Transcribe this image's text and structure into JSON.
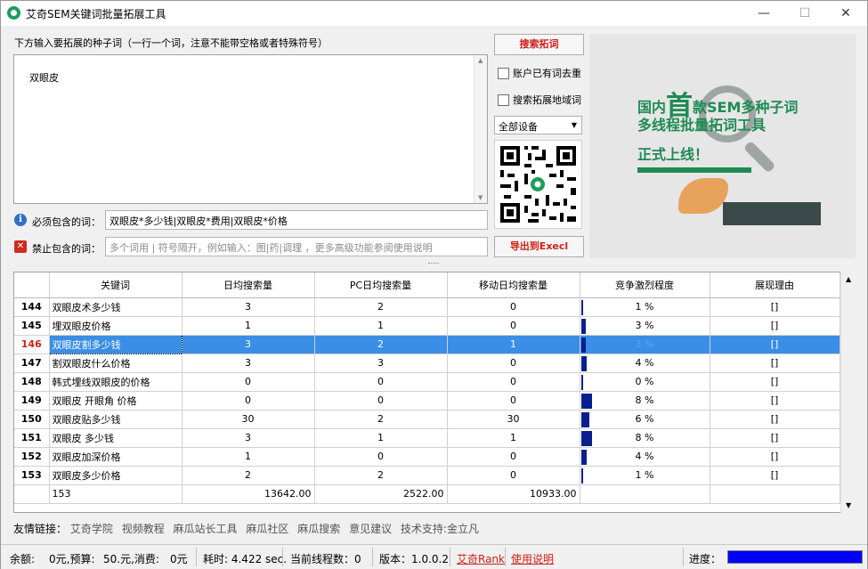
{
  "window": {
    "title": "艾奇SEM关键词批量拓展工具",
    "min": "—",
    "max": "☐",
    "close": "✕"
  },
  "seed": {
    "label": "下方输入要拓展的种子词（一行一个词，注意不能带空格或者特殊符号）",
    "value": "双眼皮"
  },
  "include": {
    "label": "必须包含的词：",
    "value": "双眼皮*多少钱|双眼皮*费用|双眼皮*价格"
  },
  "exclude": {
    "label": "禁止包含的词：",
    "placeholder": "多个词用 | 符号隔开，例如输入：图|药|调理 ，更多高级功能参阅使用说明"
  },
  "controls": {
    "search_button": "搜索拓词",
    "dedupe_checkbox": "账户已有词去重",
    "region_checkbox": "搜索拓展地域词",
    "device_select": "全部设备",
    "export_button": "导出到Execl"
  },
  "banner": {
    "line1_pre": "国内",
    "line1_big": "首",
    "line1_post": "款SEM多种子词",
    "line2": "多线程批量拓词工具",
    "line3": "正式上线！"
  },
  "table": {
    "headers": [
      "",
      "关键词",
      "日均搜索量",
      "PC日均搜索量",
      "移动日均搜索量",
      "竞争激烈程度",
      "展现理由"
    ],
    "rows": [
      {
        "num": "144",
        "kw": "双眼皮术多少钱",
        "daily": "3",
        "pc": "2",
        "mobile": "0",
        "comp": "1 %",
        "comp_level": 0.01,
        "reason": "[]"
      },
      {
        "num": "145",
        "kw": "埋双眼皮价格",
        "daily": "1",
        "pc": "1",
        "mobile": "0",
        "comp": "3 %",
        "comp_level": 0.03,
        "reason": "[]"
      },
      {
        "num": "146",
        "kw": "双眼皮割多少钱",
        "daily": "3",
        "pc": "2",
        "mobile": "1",
        "comp": "3 %",
        "comp_level": 0.03,
        "reason": "[]",
        "selected": true
      },
      {
        "num": "147",
        "kw": "割双眼皮什么价格",
        "daily": "3",
        "pc": "3",
        "mobile": "0",
        "comp": "4 %",
        "comp_level": 0.04,
        "reason": "[]"
      },
      {
        "num": "148",
        "kw": "韩式埋线双眼皮的价格",
        "daily": "0",
        "pc": "0",
        "mobile": "0",
        "comp": "0 %",
        "comp_level": 0.0,
        "reason": "[]"
      },
      {
        "num": "149",
        "kw": "双眼皮 开眼角 价格",
        "daily": "0",
        "pc": "0",
        "mobile": "0",
        "comp": "8 %",
        "comp_level": 0.08,
        "reason": "[]"
      },
      {
        "num": "150",
        "kw": "双眼皮贴多少钱",
        "daily": "30",
        "pc": "2",
        "mobile": "30",
        "comp": "6 %",
        "comp_level": 0.06,
        "reason": "[]"
      },
      {
        "num": "151",
        "kw": "双眼皮 多少钱",
        "daily": "3",
        "pc": "1",
        "mobile": "1",
        "comp": "8 %",
        "comp_level": 0.08,
        "reason": "[]"
      },
      {
        "num": "152",
        "kw": "双眼皮加深价格",
        "daily": "1",
        "pc": "0",
        "mobile": "0",
        "comp": "4 %",
        "comp_level": 0.04,
        "reason": "[]"
      },
      {
        "num": "153",
        "kw": "双眼皮多少价格",
        "daily": "2",
        "pc": "2",
        "mobile": "0",
        "comp": "1 %",
        "comp_level": 0.01,
        "reason": "[]"
      }
    ],
    "totals": {
      "count": "153",
      "daily": "13642.00",
      "pc": "2522.00",
      "mobile": "10933.00"
    }
  },
  "links": {
    "label": "友情链接：",
    "items": [
      "艾奇学院",
      "视频教程",
      "麻瓜站长工具",
      "麻瓜社区",
      "麻瓜搜索",
      "意见建议",
      "技术支持:金立凡"
    ]
  },
  "status": {
    "balance": "余额:",
    "balance_val": "0元,预算:",
    "budget_val": "50.元,消费:",
    "spend_val": "0元",
    "elapsed": "耗时: 4.422 sec.",
    "threads": "当前线程数：0",
    "version": "版本：1.0.0.2",
    "rank_link": "艾奇Rank",
    "help_link": "使用说明",
    "progress_label": "进度：",
    "progress_level": 1.0
  },
  "colors": {
    "accent_red": "#d0201a",
    "selection_blue": "#3a8ee6",
    "banner_green": "#1f8a55",
    "progress_blue": "#0000ff"
  }
}
